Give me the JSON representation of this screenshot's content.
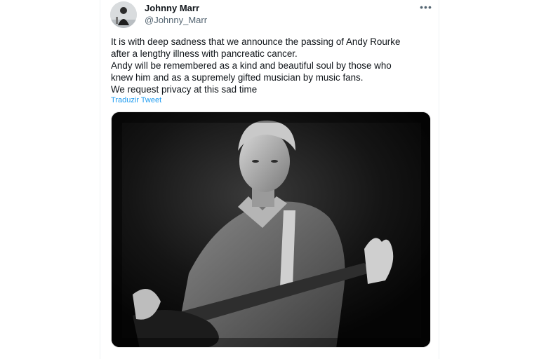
{
  "author": {
    "name": "Johnny Marr",
    "handle": "@Johnny_Marr",
    "avatar_icon": "user-avatar-photo"
  },
  "more_icon": "more-options-icon",
  "tweet": {
    "lines": [
      "It is with deep sadness that we announce the passing of Andy Rourke",
      "after a lengthy illness with pancreatic cancer.",
      "Andy will be remembered as a kind and beautiful soul by those who",
      "knew him and as a supremely gifted musician by music fans.",
      "We request privacy at this sad time"
    ],
    "translate_label": "Traduzir Tweet"
  },
  "colors": {
    "link": "#1d9bf0",
    "handle": "#536471",
    "text": "#0f1419"
  }
}
